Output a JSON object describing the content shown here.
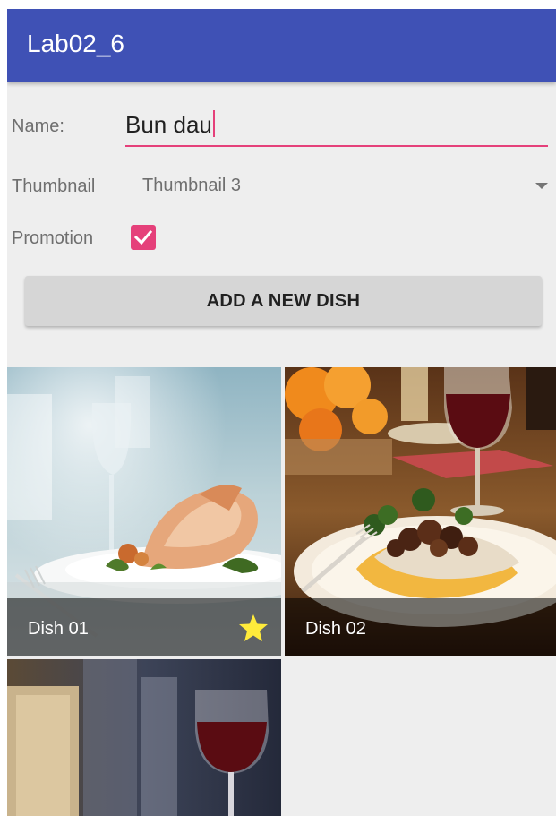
{
  "app": {
    "title": "Lab02_6"
  },
  "form": {
    "name_label": "Name:",
    "name_value": "Bun dau",
    "thumbnail_label": "Thumbnail",
    "thumbnail_selected": "Thumbnail 3",
    "promotion_label": "Promotion",
    "promotion_checked": true,
    "add_button_label": "ADD A NEW DISH"
  },
  "dishes": [
    {
      "caption": "Dish 01",
      "promotion": true
    },
    {
      "caption": "Dish 02",
      "promotion": false
    },
    {
      "caption": "",
      "promotion": false
    }
  ],
  "colors": {
    "app_bar": "#3f51b5",
    "accent": "#e5407a",
    "background": "#eeeeee",
    "button": "#d6d6d6",
    "star": "#ffeb3b"
  }
}
